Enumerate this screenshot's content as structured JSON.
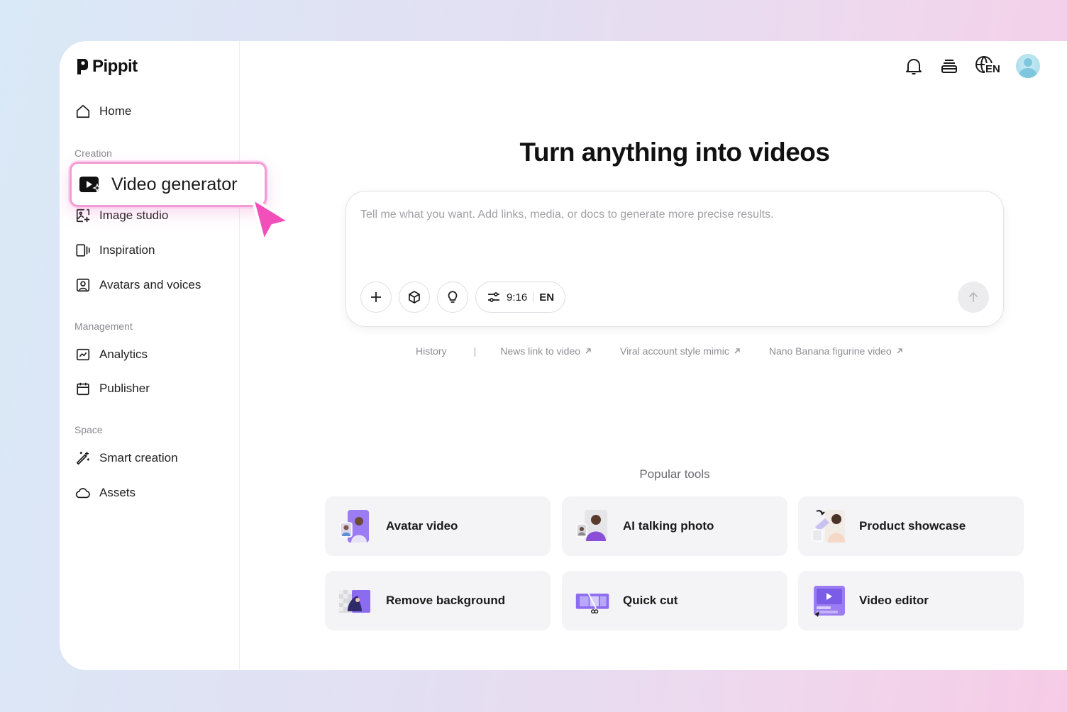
{
  "app": {
    "name": "Pippit"
  },
  "sidebar": {
    "home": "Home",
    "sections": {
      "creation": "Creation",
      "management": "Management",
      "space": "Space"
    },
    "creation_items": [
      {
        "label": "Video generator",
        "icon": "video-generator-icon",
        "selected": true
      },
      {
        "label": "Image studio",
        "icon": "image-studio-icon"
      },
      {
        "label": "Inspiration",
        "icon": "inspiration-icon"
      },
      {
        "label": "Avatars and voices",
        "icon": "avatar-icon"
      }
    ],
    "management_items": [
      {
        "label": "Analytics",
        "icon": "analytics-icon"
      },
      {
        "label": "Publisher",
        "icon": "calendar-icon"
      }
    ],
    "space_items": [
      {
        "label": "Smart creation",
        "icon": "magic-wand-icon"
      },
      {
        "label": "Assets",
        "icon": "cloud-icon"
      }
    ]
  },
  "topbar": {
    "icons": [
      "bell-icon",
      "stack-icon",
      "globe-language-icon",
      "user-avatar"
    ],
    "language_code": "EN"
  },
  "main": {
    "title": "Turn anything into videos",
    "prompt": {
      "placeholder": "Tell me what you want. Add links, media, or docs to generate more precise results.",
      "aspect_ratio": "9:16",
      "language": "EN"
    },
    "quick_links": [
      {
        "label": "History",
        "external": false
      },
      {
        "label": "News link to video",
        "external": true
      },
      {
        "label": "Viral account style mimic",
        "external": true
      },
      {
        "label": "Nano Banana figurine video",
        "external": true
      }
    ],
    "popular_label": "Popular tools",
    "tools": [
      {
        "label": "Avatar video"
      },
      {
        "label": "AI talking photo"
      },
      {
        "label": "Product showcase"
      },
      {
        "label": "Remove background"
      },
      {
        "label": "Quick cut"
      },
      {
        "label": "Video editor"
      }
    ]
  },
  "colors": {
    "accent_pink": "#f06fc4",
    "tool_purple": "#8b6cf0"
  }
}
